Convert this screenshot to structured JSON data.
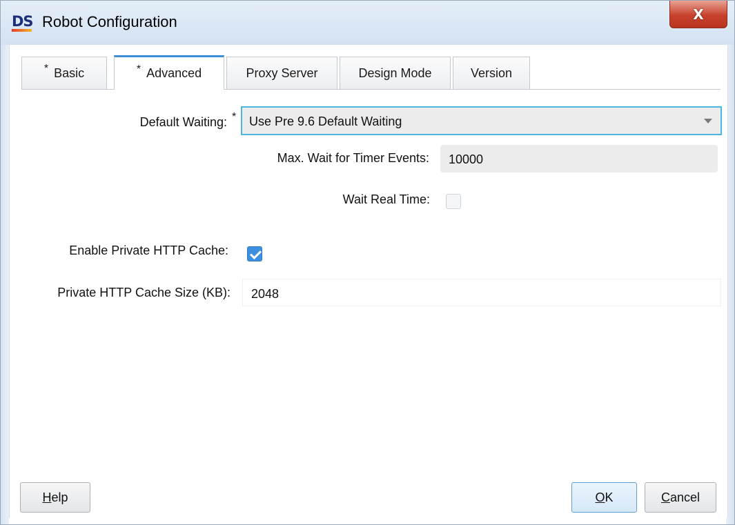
{
  "window": {
    "logo_text": "DS",
    "title": "Robot Configuration",
    "close_label": "X"
  },
  "tabs": [
    {
      "label": "Basic",
      "marker": "*",
      "active": false
    },
    {
      "label": "Advanced",
      "marker": "*",
      "active": true
    },
    {
      "label": "Proxy Server",
      "marker": "",
      "active": false
    },
    {
      "label": "Design Mode",
      "marker": "",
      "active": false
    },
    {
      "label": "Version",
      "marker": "",
      "active": false
    }
  ],
  "form": {
    "default_waiting": {
      "label": "Default Waiting:",
      "required_marker": "*",
      "value": "Use Pre 9.6 Default Waiting"
    },
    "max_wait": {
      "label": "Max. Wait for Timer Events:",
      "value": "10000"
    },
    "wait_real_time": {
      "label": "Wait Real Time:",
      "checked": false
    },
    "enable_cache": {
      "label": "Enable Private HTTP Cache:",
      "checked": true
    },
    "cache_size": {
      "label": "Private HTTP Cache Size (KB):",
      "value": "2048"
    }
  },
  "buttons": {
    "help": {
      "mnemonic": "H",
      "rest": "elp"
    },
    "ok": {
      "mnemonic": "O",
      "rest": "K"
    },
    "cancel": {
      "mnemonic": "C",
      "rest": "ancel"
    }
  },
  "colors": {
    "active_tab_accent": "#3e8ed8",
    "focus_border": "#4ab6e0",
    "checkbox_checked": "#3d8fe0",
    "close_button": "#c8412c"
  }
}
